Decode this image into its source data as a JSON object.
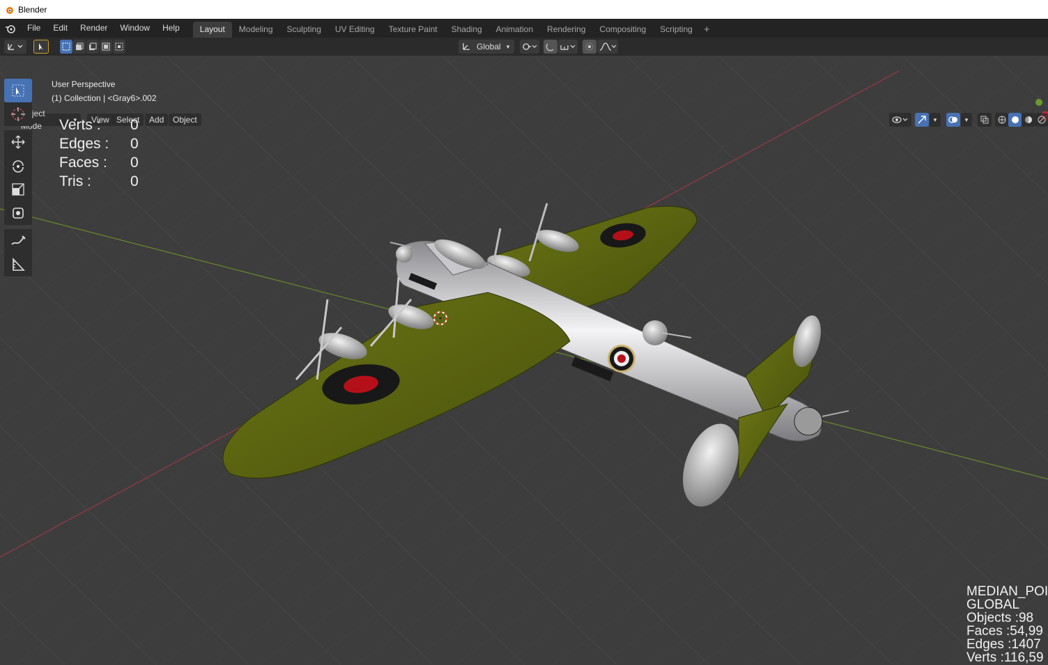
{
  "window": {
    "title": "Blender"
  },
  "menu": {
    "file": "File",
    "edit": "Edit",
    "render": "Render",
    "window": "Window",
    "help": "Help"
  },
  "workspaces": [
    {
      "label": "Layout"
    },
    {
      "label": "Modeling"
    },
    {
      "label": "Sculpting"
    },
    {
      "label": "UV Editing"
    },
    {
      "label": "Texture Paint"
    },
    {
      "label": "Shading"
    },
    {
      "label": "Animation"
    },
    {
      "label": "Rendering"
    },
    {
      "label": "Compositing"
    },
    {
      "label": "Scripting"
    }
  ],
  "add_workspace": "+",
  "toolheader": {
    "transform_orientation": "Global"
  },
  "viewport_header": {
    "mode": "Object Mode",
    "view": "View",
    "select": "Select",
    "add": "Add",
    "object": "Object"
  },
  "overlay": {
    "perspective": "User Perspective",
    "collection": "(1) Collection | <Gray6>.002",
    "stats": [
      {
        "label": "Verts :",
        "value": "0"
      },
      {
        "label": "Edges :",
        "value": "0"
      },
      {
        "label": "Faces :",
        "value": "0"
      },
      {
        "label": "Tris :",
        "value": "0"
      }
    ]
  },
  "scene_stats": {
    "pivot": "MEDIAN_POI",
    "orientation": "GLOBAL",
    "objects": "Objects :98",
    "faces": "Faces :54,99",
    "edges": "Edges :1407",
    "verts": "Verts :116,59"
  },
  "colors": {
    "accent": "#4772b3",
    "viewport_bg": "#3d3d3d",
    "wing": "#5a6410",
    "fuselage": "#d8d8dc",
    "roundel_red": "#b5101a"
  }
}
